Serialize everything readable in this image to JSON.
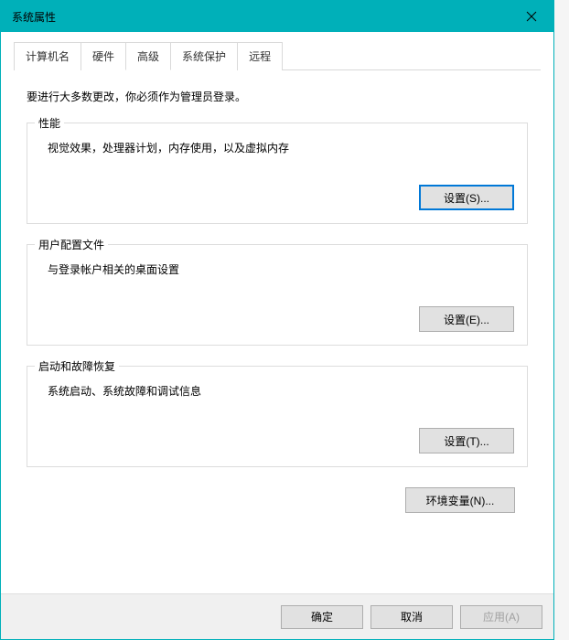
{
  "window": {
    "title": "系统属性"
  },
  "tabs": {
    "computer_name": "计算机名",
    "hardware": "硬件",
    "advanced": "高级",
    "system_protection": "系统保护",
    "remote": "远程"
  },
  "intro": "要进行大多数更改，你必须作为管理员登录。",
  "groups": {
    "performance": {
      "title": "性能",
      "desc": "视觉效果，处理器计划，内存使用，以及虚拟内存",
      "button": "设置(S)..."
    },
    "user_profiles": {
      "title": "用户配置文件",
      "desc": "与登录帐户相关的桌面设置",
      "button": "设置(E)..."
    },
    "startup_recovery": {
      "title": "启动和故障恢复",
      "desc": "系统启动、系统故障和调试信息",
      "button": "设置(T)..."
    }
  },
  "env_vars_button": "环境变量(N)...",
  "footer": {
    "ok": "确定",
    "cancel": "取消",
    "apply": "应用(A)"
  }
}
